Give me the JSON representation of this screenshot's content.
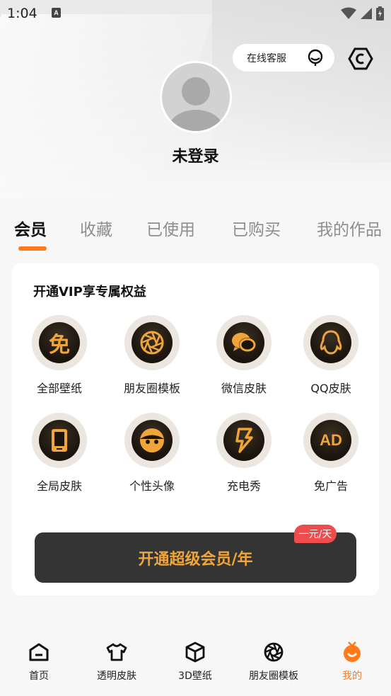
{
  "status_bar": {
    "time": "1:04"
  },
  "header": {
    "service_label": "在线客服",
    "username": "未登录"
  },
  "tabs": [
    {
      "label": "会员",
      "active": true
    },
    {
      "label": "收藏",
      "active": false
    },
    {
      "label": "已使用",
      "active": false
    },
    {
      "label": "已购买",
      "active": false
    },
    {
      "label": "我的作品",
      "active": false
    }
  ],
  "vip_card": {
    "title": "开通VIP享专属权益",
    "perks": [
      {
        "label": "全部壁纸",
        "icon": "free-icon",
        "glyph": "免"
      },
      {
        "label": "朋友圈模板",
        "icon": "aperture-icon"
      },
      {
        "label": "微信皮肤",
        "icon": "wechat-icon"
      },
      {
        "label": "QQ皮肤",
        "icon": "qq-icon"
      },
      {
        "label": "全局皮肤",
        "icon": "phone-icon"
      },
      {
        "label": "个性头像",
        "icon": "face-icon"
      },
      {
        "label": "充电秀",
        "icon": "lightning-icon"
      },
      {
        "label": "免广告",
        "icon": "ad-free-icon",
        "glyph": "AD"
      }
    ],
    "cta_label": "开通超级会员/年",
    "price_badge": "一元/天"
  },
  "bottom_nav": [
    {
      "label": "首页",
      "icon": "home-icon",
      "active": false
    },
    {
      "label": "透明皮肤",
      "icon": "shirt-icon",
      "active": false
    },
    {
      "label": "3D壁纸",
      "icon": "cube-icon",
      "active": false
    },
    {
      "label": "朋友圈模板",
      "icon": "aperture-icon",
      "active": false
    },
    {
      "label": "我的",
      "icon": "profile-icon",
      "active": true
    }
  ],
  "colors": {
    "accent": "#ff7a1a",
    "gold": "#f0a53a",
    "badge": "#ef4d4d",
    "cta_bg": "#343434"
  }
}
